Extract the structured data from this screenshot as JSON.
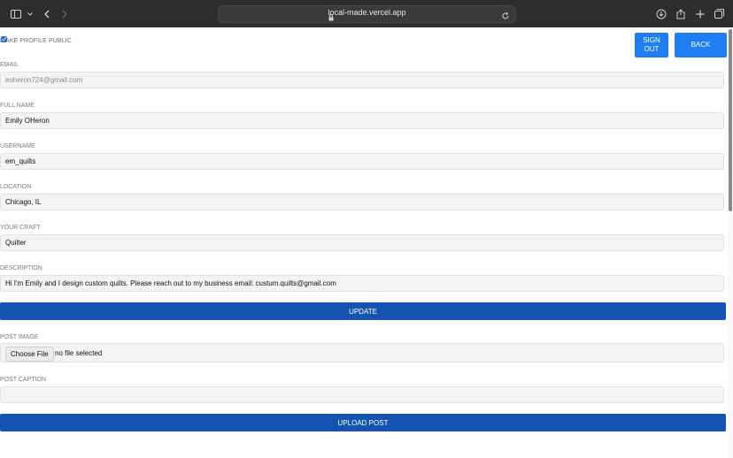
{
  "browser": {
    "url": "local-made.vercel.app"
  },
  "profile": {
    "public_label": "MAKE PROFILE PUBLIC",
    "public_checked": true,
    "sign_out_label": "SIGN OUT",
    "back_label": "BACK",
    "email_label": "EMAIL",
    "email_value": "eoheron724@gmail.com",
    "full_name_label": "FULL NAME",
    "full_name_value": "Emily OHeron",
    "username_label": "USERNAME",
    "username_value": "em_quilts",
    "location_label": "LOCATION",
    "location_value": "Chicago, IL",
    "craft_label": "YOUR CRAFT",
    "craft_value": "Quilter",
    "description_label": "DESCRIPTION",
    "description_value": "Hi I'm Emily and I design custom quilts. Please reach out to my business email: custum.quilts@gmail.com",
    "update_label": "UPDATE"
  },
  "post": {
    "image_label": "POST IMAGE",
    "choose_file_label": "Choose File",
    "file_status": "no file selected",
    "caption_label": "POST CAPTION",
    "caption_value": "",
    "upload_label": "UPLOAD POST"
  },
  "colors": {
    "primary_button": "#1f7ff2",
    "wide_button": "#1454b0",
    "field_bg": "#f4f4f4"
  }
}
